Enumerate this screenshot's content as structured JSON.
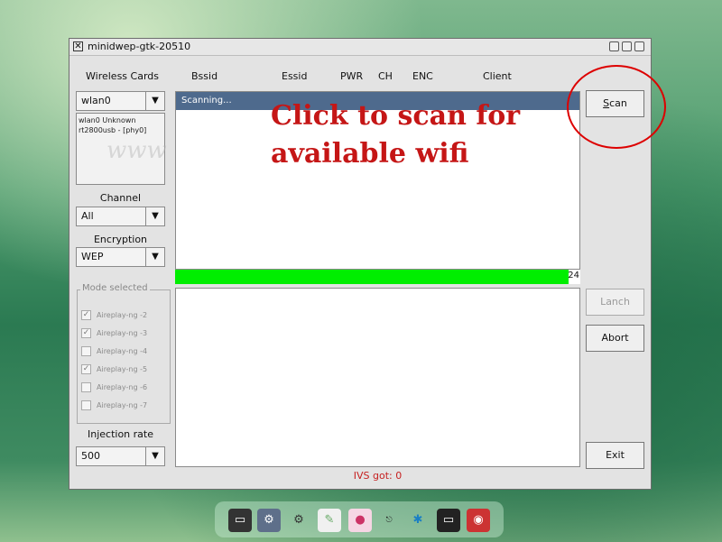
{
  "window": {
    "title": "minidwep-gtk-20510"
  },
  "columns": {
    "wireless_cards": "Wireless Cards",
    "bssid": "Bssid",
    "essid": "Essid",
    "pwr": "PWR",
    "ch": "CH",
    "enc": "ENC",
    "client": "Client"
  },
  "sidebar": {
    "card_select": "wlan0",
    "card_info_line1": "wlan0 Unknown",
    "card_info_line2": "rt2800usb - [phy0]",
    "channel_label": "Channel",
    "channel_select": "All",
    "encryption_label": "Encryption",
    "encryption_select": "WEP",
    "mode_title": "Mode selected",
    "modes": [
      {
        "label": "Aireplay-ng -2",
        "checked": true
      },
      {
        "label": "Aireplay-ng -3",
        "checked": true
      },
      {
        "label": "Aireplay-ng -4",
        "checked": false
      },
      {
        "label": "Aireplay-ng -5",
        "checked": true
      },
      {
        "label": "Aireplay-ng -6",
        "checked": false
      },
      {
        "label": "Aireplay-ng -7",
        "checked": false
      }
    ],
    "injection_label": "Injection rate",
    "injection_select": "500"
  },
  "scan_list": {
    "status_row": "Scanning..."
  },
  "progress": {
    "value_text": "24",
    "fraction": 0.97
  },
  "buttons": {
    "scan": "Scan",
    "lanch": "Lanch",
    "abort": "Abort",
    "exit": "Exit"
  },
  "status": {
    "ivs": "IVS got: 0"
  },
  "annotation": {
    "line1": "Click to scan for",
    "line2": "available wifi",
    "watermark": "www"
  },
  "colors": {
    "progress": "#00ee00",
    "annotation": "#c51616",
    "selection": "#4e6a8d"
  },
  "taskbar_icons": [
    "terminal-icon",
    "settings-icon",
    "gears-icon",
    "doc-icon",
    "baby-bottle-icon",
    "logout-icon",
    "network-icon",
    "console-icon",
    "camera-icon"
  ]
}
